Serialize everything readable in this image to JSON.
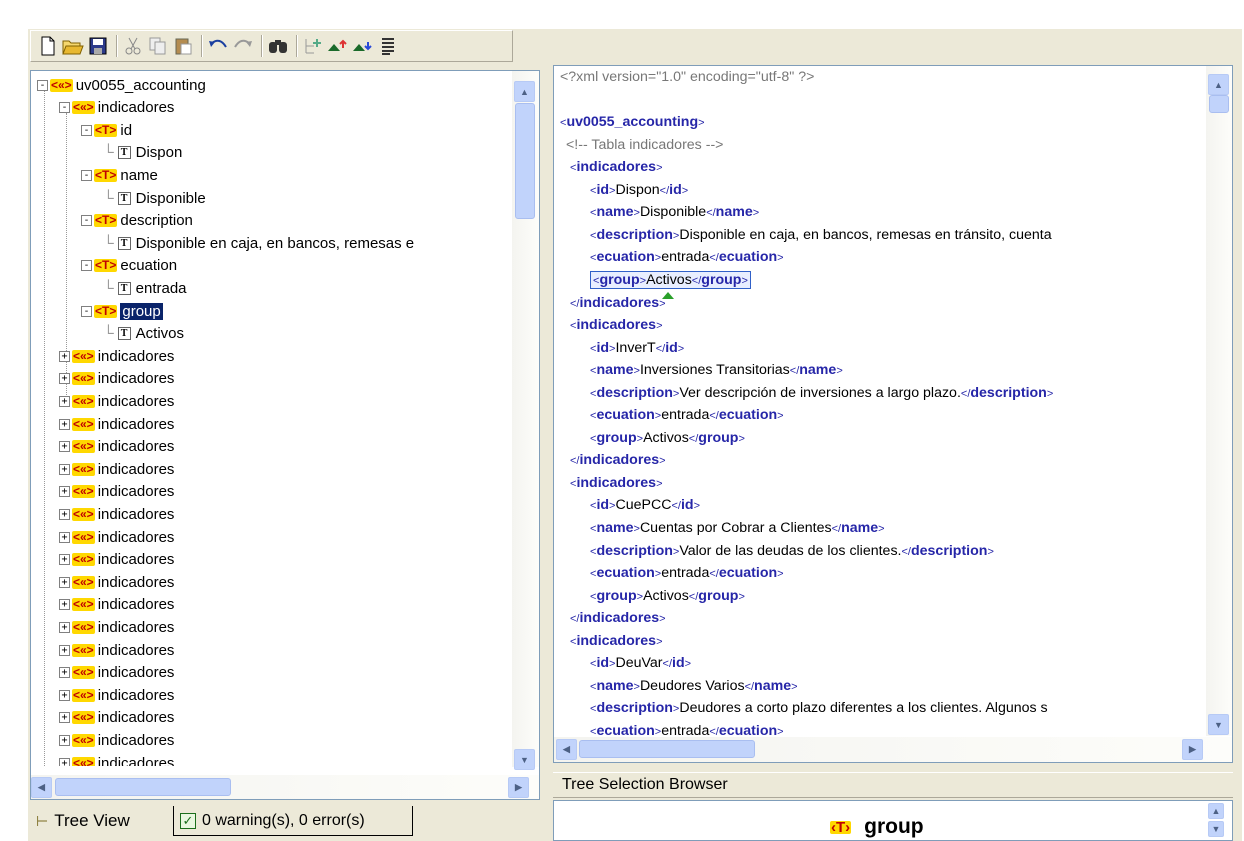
{
  "toolbar": {
    "buttons": [
      "new-file-icon",
      "open-folder-icon",
      "save-icon",
      "cut-icon",
      "copy-icon",
      "paste-icon",
      "undo-icon",
      "redo-icon",
      "find-icon",
      "tree-insert-icon",
      "move-up-icon",
      "move-down-icon",
      "format-icon"
    ]
  },
  "tree": {
    "root": "uv0055_accounting",
    "expanded": {
      "label": "indicadores",
      "children": [
        {
          "tag": "id",
          "text": "Dispon"
        },
        {
          "tag": "name",
          "text": "Disponible"
        },
        {
          "tag": "description",
          "text": "Disponible en caja, en bancos, remesas e"
        },
        {
          "tag": "ecuation",
          "text": "entrada"
        },
        {
          "tag": "group",
          "text": "Activos"
        }
      ]
    },
    "collapsed_label": "indicadores",
    "collapsed_count": 19
  },
  "tabs": {
    "tree_view": "Tree View",
    "warnings": "0 warning(s), 0 error(s)"
  },
  "xml": {
    "decl": "<?xml version=\"1.0\" encoding=\"utf-8\" ?>",
    "root": "uv0055_accounting",
    "comment": "<!-- Tabla indicadores -->",
    "records": [
      {
        "id": "Dispon",
        "name": "Disponible",
        "description": "Disponible en caja, en bancos, remesas en tránsito, cuenta",
        "ecuation": "entrada",
        "group": "Activos",
        "desc_close": false
      },
      {
        "id": "InverT",
        "name": "Inversiones Transitorias",
        "description": "Ver descripción de inversiones a largo plazo.",
        "ecuation": "entrada",
        "group": "Activos",
        "desc_close": true
      },
      {
        "id": "CuePCC",
        "name": "Cuentas por Cobrar a Clientes",
        "description": "Valor de las deudas de los clientes.",
        "ecuation": "entrada",
        "group": "Activos",
        "desc_close": true
      },
      {
        "id": "DeuVar",
        "name": "Deudores Varios",
        "description": "Deudores a corto plazo diferentes a los clientes. Algunos  s",
        "ecuation": "entrada",
        "group": "",
        "desc_close": false
      }
    ]
  },
  "tree_selection_browser": {
    "header": "Tree Selection Browser",
    "selected": "group"
  },
  "colors": {
    "accent": "#0a246a",
    "tag": "#2626a8",
    "chrome": "#ece9d8"
  }
}
